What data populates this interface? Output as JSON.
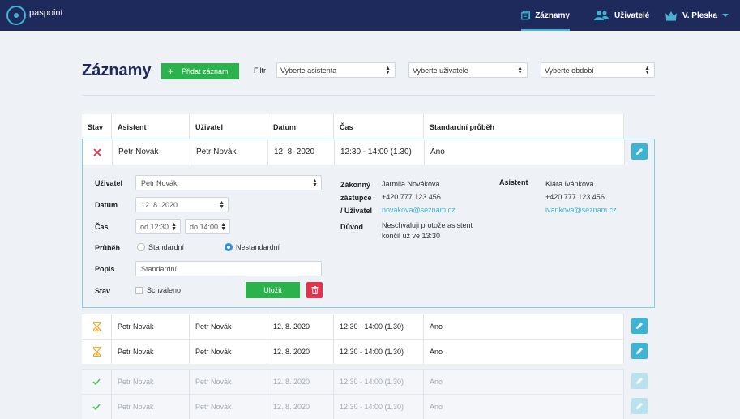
{
  "app": {
    "logo_text": "paspoint"
  },
  "nav": {
    "records": "Záznamy",
    "users": "Uživatelé",
    "account": "V. Pleska",
    "accent": "#3fb5d3"
  },
  "page": {
    "title": "Záznamy",
    "add_button": "Přidat záznam",
    "filter_label": "Filtr",
    "filter_assistant": "Vyberte asistenta",
    "filter_user": "Vyberte uživatele",
    "filter_period": "Vyberte období"
  },
  "table": {
    "headers": [
      "Stav",
      "Asistent",
      "Uživatel",
      "Datum",
      "Čas",
      "Standardní průběh"
    ],
    "rows": [
      {
        "status": "rejected",
        "assistant": "Petr Novák",
        "user": "Petr Novák",
        "date": "12. 8. 2020",
        "time": "12:30 - 14:00 (1.30)",
        "standard": "Ano"
      },
      {
        "status": "pending",
        "assistant": "Petr Novák",
        "user": "Petr Novák",
        "date": "12. 8. 2020",
        "time": "12:30 - 14:00 (1.30)",
        "standard": "Ano"
      },
      {
        "status": "pending",
        "assistant": "Petr Novák",
        "user": "Petr Novák",
        "date": "12. 8. 2020",
        "time": "12:30 - 14:00 (1.30)",
        "standard": "Ano"
      },
      {
        "status": "approved",
        "assistant": "Petr Novák",
        "user": "Petr Novák",
        "date": "12. 8. 2020",
        "time": "12:30 - 14:00 (1.30)",
        "standard": "Ano"
      },
      {
        "status": "approved",
        "assistant": "Petr Novák",
        "user": "Petr Novák",
        "date": "12. 8. 2020",
        "time": "12:30 - 14:00 (1.30)",
        "standard": "Ano"
      }
    ]
  },
  "detail": {
    "user_label": "Uživatel",
    "user_value": "Petr Novák",
    "date_label": "Datum",
    "date_value": "12. 8. 2020",
    "time_label": "Čas",
    "time_from": "od 12:30",
    "time_to": "do 14:00",
    "progress_label": "Průběh",
    "radio_standard": "Standardní",
    "radio_nonstandard": "Nestandardní",
    "selected_progress": "Nestandardní",
    "description_label": "Popis",
    "description_value": "Standardní",
    "state_label": "Stav",
    "approved_label": "Schváleno",
    "approved_checked": false,
    "save_button": "Uložit",
    "guardian_label_1": "Zákonný",
    "guardian_label_2": "zástupce",
    "guardian_label_3": "/ Uživatel",
    "guardian_name": "Jarmila Nováková",
    "guardian_phone": "+420 777 123 456",
    "guardian_email": "novakova@seznam.cz",
    "assistant_label": "Asistent",
    "assistant_name": "Klára Ivánková",
    "assistant_phone": "+420 777 123 456",
    "assistant_email": "ivankova@seznam.cz",
    "reason_label": "Důvod",
    "reason_line1": "Neschvaluji protože asistent",
    "reason_line2": "končil už ve 13:30"
  },
  "colors": {
    "nav_bg": "#1f2a5c",
    "add_green": "#2bb24c",
    "edit_blue": "#3cb4d6",
    "delete_red": "#e0344d",
    "reject_red": "#e0344d",
    "pending_orange": "#f5a623",
    "approved_green": "#4cc46b"
  }
}
